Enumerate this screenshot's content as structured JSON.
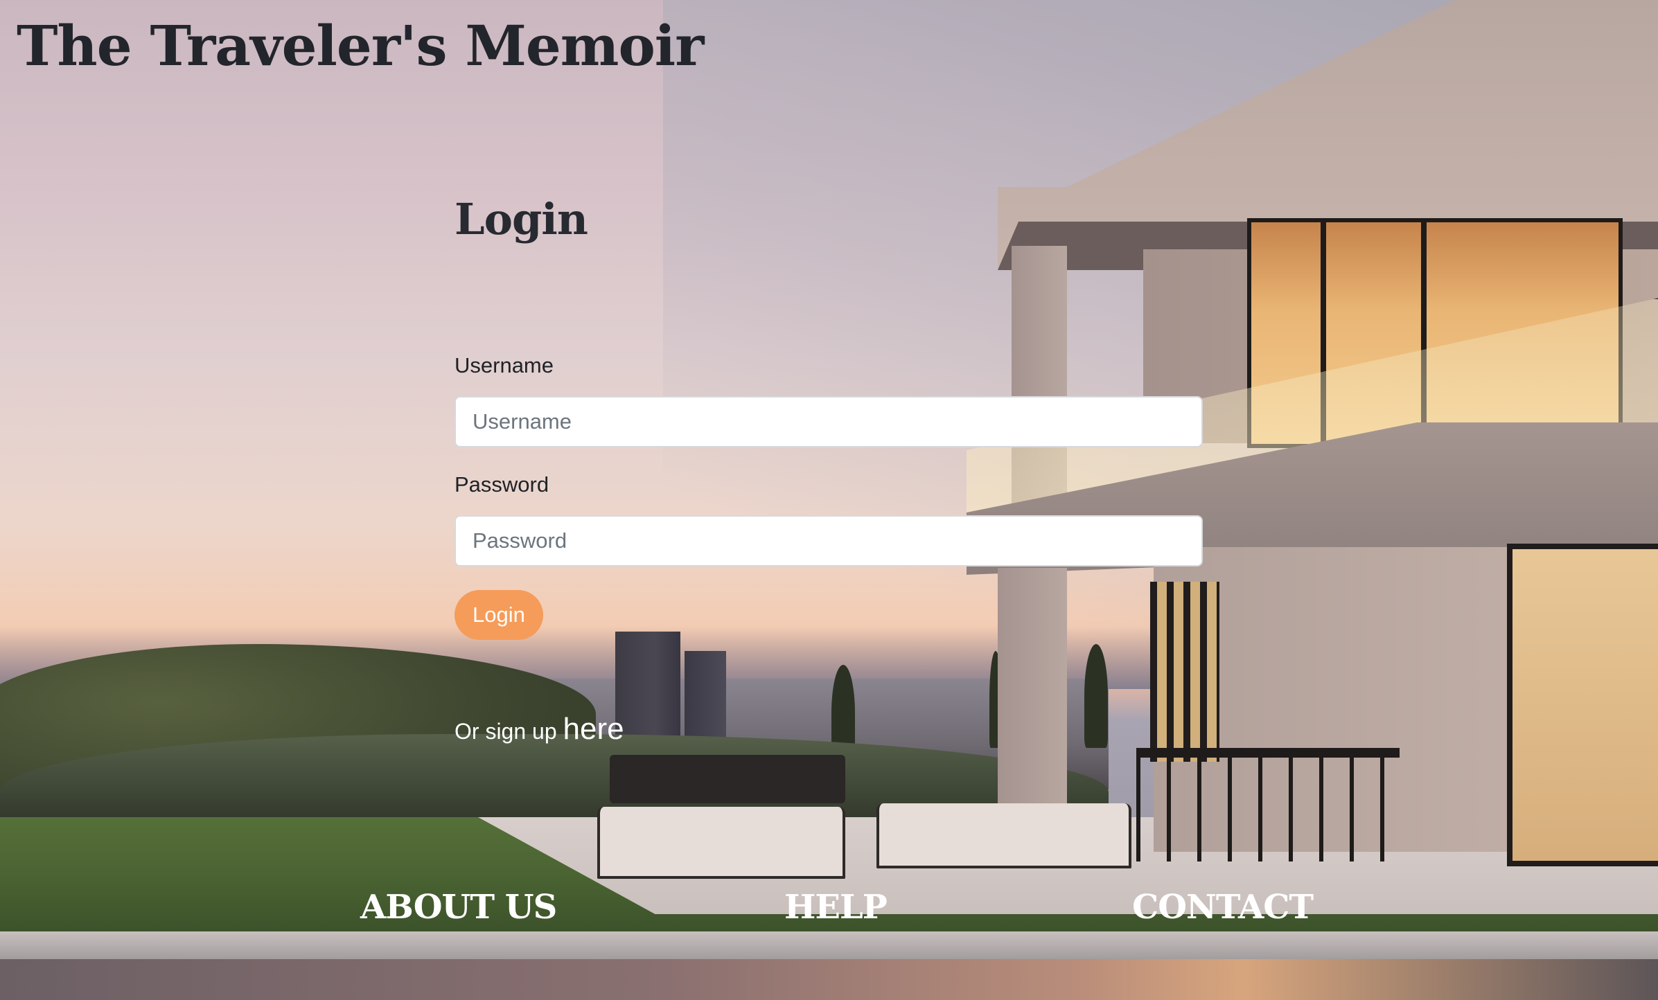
{
  "header": {
    "site_title": "The Traveler's Memoir"
  },
  "login": {
    "heading": "Login",
    "username_label": "Username",
    "username_placeholder": "Username",
    "password_label": "Password",
    "password_placeholder": "Password",
    "submit_label": "Login",
    "signup_prefix": "Or sign up ",
    "signup_link": "here"
  },
  "footer": {
    "links": [
      "ABOUT US",
      "HELP",
      "CONTACT"
    ]
  },
  "colors": {
    "title_text": "#22252b",
    "button_bg": "#f59c5a",
    "button_text": "#ffffff",
    "footer_text": "#ffffff"
  }
}
